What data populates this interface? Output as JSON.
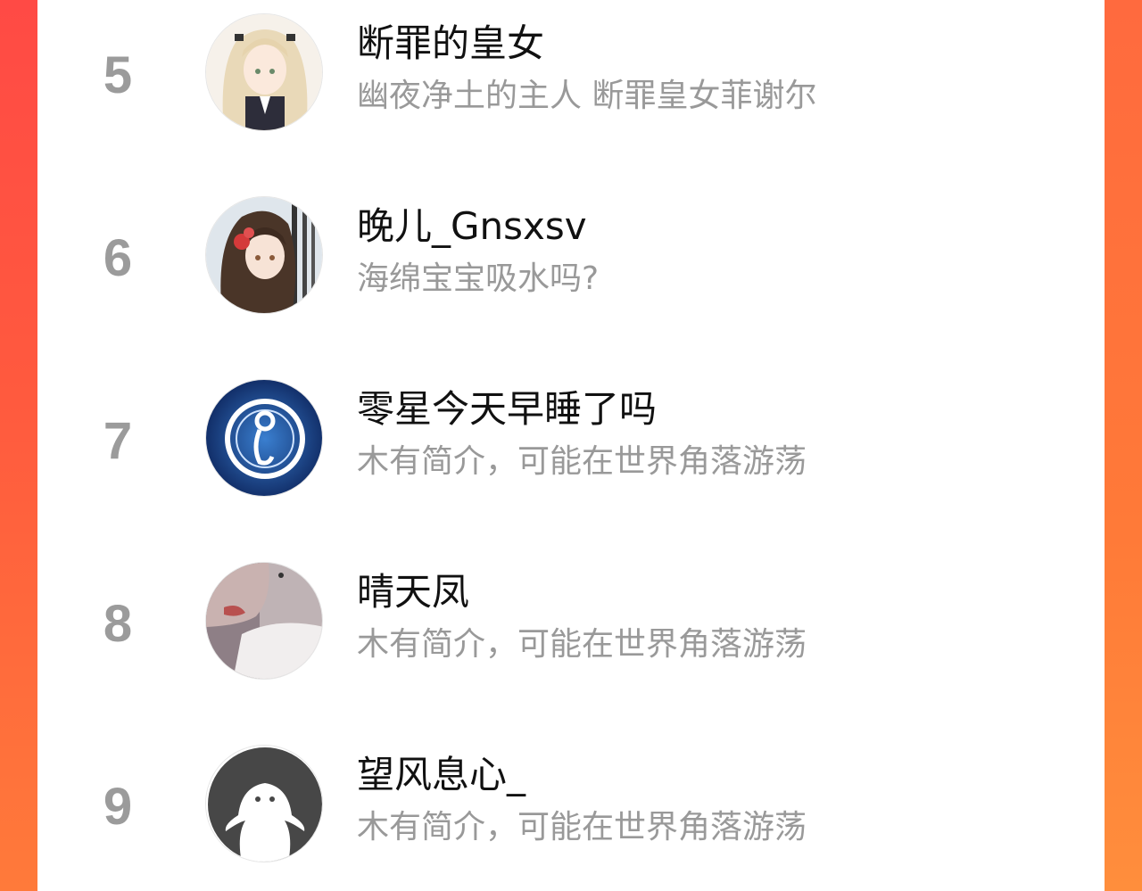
{
  "colors": {
    "page_background": "#ff5a3e",
    "card_background": "#ffffff",
    "rank_color": "#9b9b9b",
    "name_color": "#111111",
    "bio_color": "#999999"
  },
  "users": [
    {
      "rank": "5",
      "name": "断罪的皇女",
      "bio": "幽夜净土的主人 断罪皇女菲谢尔",
      "avatar": "anime-blonde-girl-avatar"
    },
    {
      "rank": "6",
      "name": "晚儿_Gnsxsv",
      "bio": "海绵宝宝吸水吗?",
      "avatar": "anime-brunette-girl-avatar"
    },
    {
      "rank": "7",
      "name": "零星今天早睡了吗",
      "bio": "木有简介，可能在世界角落游荡",
      "avatar": "blue-team-logo-avatar"
    },
    {
      "rank": "8",
      "name": "晴天凤",
      "bio": "木有简介，可能在世界角落游荡",
      "avatar": "portrait-photo-avatar"
    },
    {
      "rank": "9",
      "name": "望风息心_",
      "bio": "木有简介，可能在世界角落游荡",
      "avatar": "default-ghost-avatar"
    }
  ]
}
